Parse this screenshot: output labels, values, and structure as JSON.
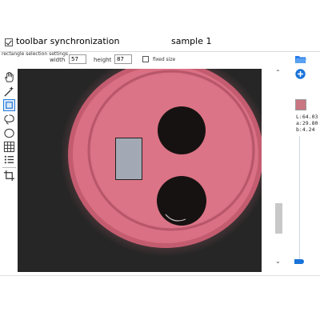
{
  "header": {
    "sync_label": "toolbar synchronization",
    "sync_checked": true,
    "title": "sample 1"
  },
  "selection_settings": {
    "title": "rectangle selection settings",
    "width_label": "width",
    "width_value": "57",
    "height_label": "height",
    "height_value": "87",
    "fixed_size_label": "fixed size",
    "fixed_size_checked": false
  },
  "tools": [
    {
      "name": "hand-icon"
    },
    {
      "name": "magic-wand-icon"
    },
    {
      "name": "rectangle-select-icon",
      "active": true
    },
    {
      "name": "lasso-icon"
    },
    {
      "name": "ellipse-select-icon"
    },
    {
      "name": "grid-icon"
    },
    {
      "name": "list-icon"
    },
    {
      "name": "crop-icon"
    }
  ],
  "right_panel": {
    "color_hex": "#c97682",
    "lab": [
      "L:64.03",
      "a:29.80",
      "b:4.24"
    ]
  },
  "colors": {
    "accent": "#1a73d9",
    "sample_pink": "#d97083",
    "background_dark": "#262626"
  }
}
